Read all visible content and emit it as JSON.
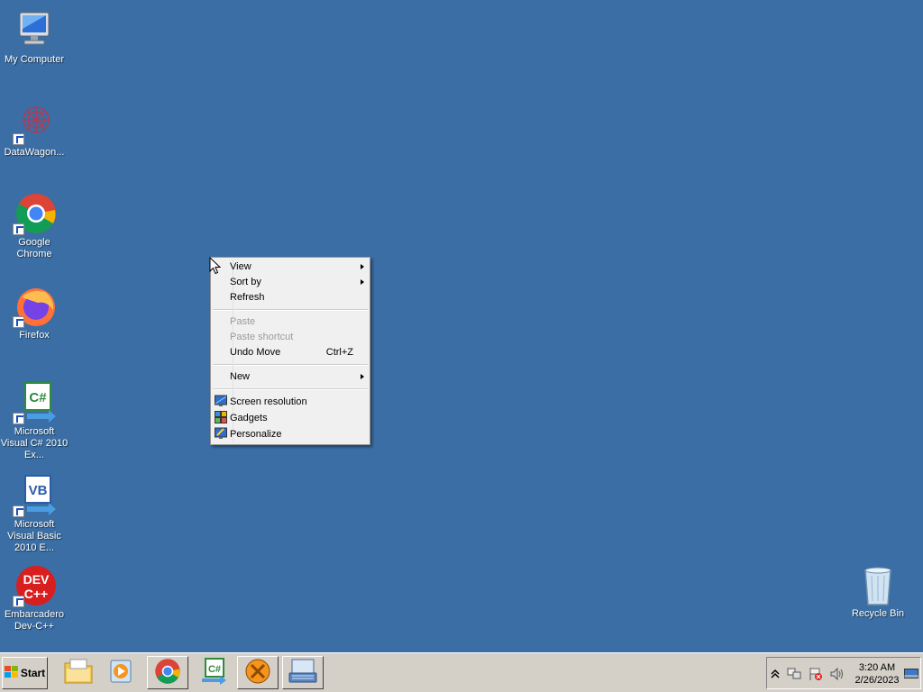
{
  "desktop": {
    "icons": [
      {
        "label": "My Computer"
      },
      {
        "label": "DataWagon..."
      },
      {
        "label": "Google Chrome"
      },
      {
        "label": "Firefox"
      },
      {
        "label": "Microsoft Visual C# 2010 Ex..."
      },
      {
        "label": "Microsoft Visual Basic 2010 E..."
      },
      {
        "label": "Embarcadero Dev-C++"
      },
      {
        "label": "Recycle Bin"
      }
    ]
  },
  "context_menu": {
    "items": [
      {
        "label": "View"
      },
      {
        "label": "Sort by"
      },
      {
        "label": "Refresh"
      },
      {
        "label": "Paste"
      },
      {
        "label": "Paste shortcut"
      },
      {
        "label": "Undo Move",
        "shortcut": "Ctrl+Z"
      },
      {
        "label": "New"
      },
      {
        "label": "Screen resolution"
      },
      {
        "label": "Gadgets"
      },
      {
        "label": "Personalize"
      }
    ]
  },
  "taskbar": {
    "start_label": "Start",
    "clock": {
      "time": "3:20 AM",
      "date": "2/26/2023"
    }
  },
  "colors": {
    "desktop_bg": "#3a6ea5",
    "taskbar_bg": "#d4d0c8"
  }
}
